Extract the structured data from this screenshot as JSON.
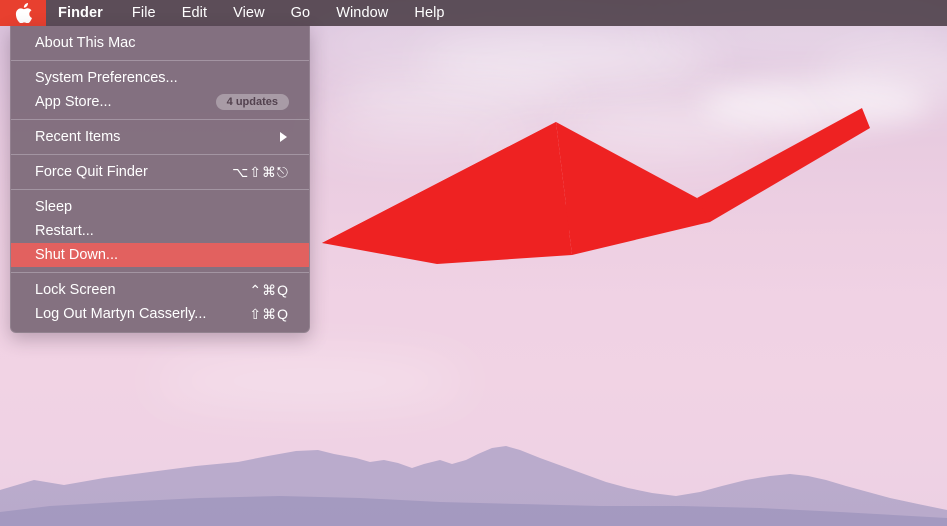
{
  "menubar": {
    "apple_icon": "apple-logo-icon",
    "items": [
      {
        "label": "Finder",
        "bold": true
      },
      {
        "label": "File",
        "bold": false
      },
      {
        "label": "Edit",
        "bold": false
      },
      {
        "label": "View",
        "bold": false
      },
      {
        "label": "Go",
        "bold": false
      },
      {
        "label": "Window",
        "bold": false
      },
      {
        "label": "Help",
        "bold": false
      }
    ]
  },
  "apple_menu": {
    "items": [
      {
        "label": "About This Mac",
        "accel": "",
        "badge": "",
        "selected": false,
        "submenu": false
      },
      {
        "label": "System Preferences...",
        "accel": "",
        "badge": "",
        "selected": false,
        "submenu": false
      },
      {
        "label": "App Store...",
        "accel": "",
        "badge": "4 updates",
        "selected": false,
        "submenu": false
      },
      {
        "label": "Recent Items",
        "accel": "",
        "badge": "",
        "selected": false,
        "submenu": true
      },
      {
        "label": "Force Quit Finder",
        "accel": "⌥⇧⌘⎋",
        "badge": "",
        "selected": false,
        "submenu": false
      },
      {
        "label": "Sleep",
        "accel": "",
        "badge": "",
        "selected": false,
        "submenu": false
      },
      {
        "label": "Restart...",
        "accel": "",
        "badge": "",
        "selected": false,
        "submenu": false
      },
      {
        "label": "Shut Down...",
        "accel": "",
        "badge": "",
        "selected": true,
        "submenu": false
      },
      {
        "label": "Lock Screen",
        "accel": "⌃⌘Q",
        "badge": "",
        "selected": false,
        "submenu": false
      },
      {
        "label": "Log Out Martyn Casserly...",
        "accel": "⇧⌘Q",
        "badge": "",
        "selected": false,
        "submenu": false
      }
    ]
  },
  "annotation": {
    "name": "red-arrow-pointing-to-shut-down",
    "color": "#ee2222"
  },
  "colors": {
    "menubar_bg": "#4a3c46",
    "apple_highlight": "#e8402f",
    "menu_bg": "#7c6978",
    "selected_row": "#e2615f",
    "wallpaper_pink": "#f0d2e4",
    "mountain": "#9a93bd"
  }
}
